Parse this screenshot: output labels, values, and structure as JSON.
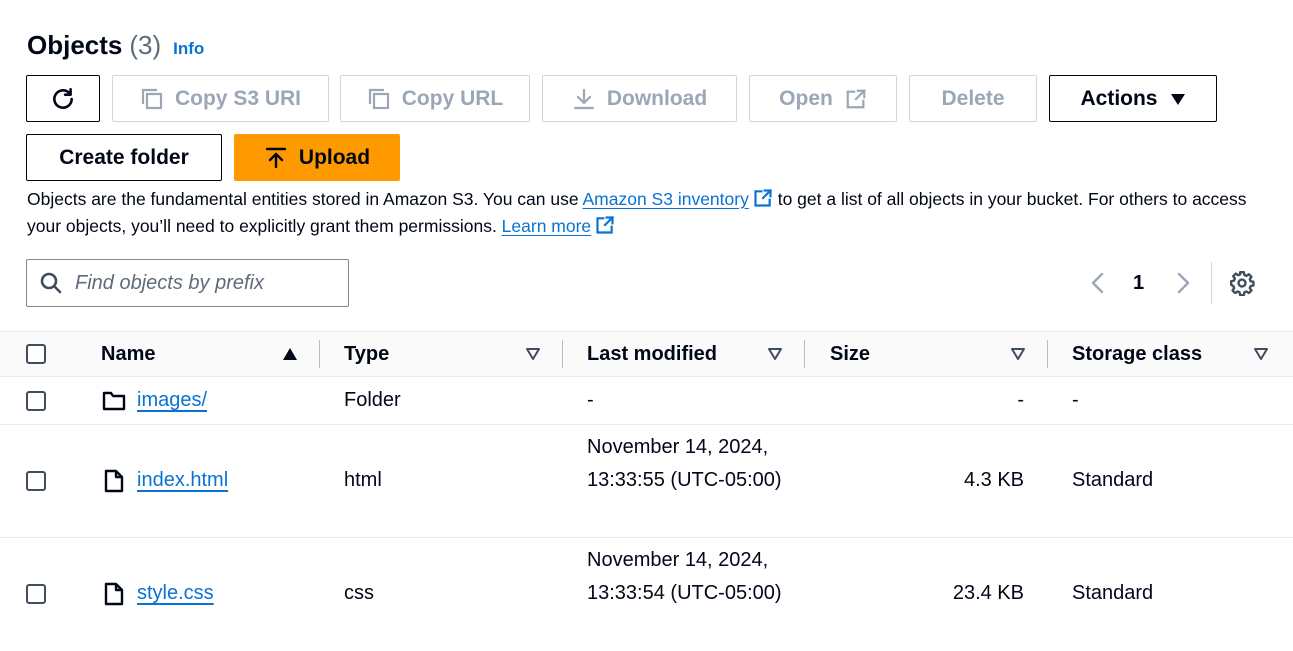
{
  "header": {
    "title": "Objects",
    "count": "(3)",
    "info": "Info"
  },
  "toolbar": {
    "copy_s3_uri": "Copy S3 URI",
    "copy_url": "Copy URL",
    "download": "Download",
    "open": "Open",
    "delete": "Delete",
    "actions": "Actions",
    "create_folder": "Create folder",
    "upload": "Upload"
  },
  "description": {
    "part1": "Objects are the fundamental entities stored in Amazon S3. You can use ",
    "link1": "Amazon S3 inventory",
    "part2": " to get a list of all objects in your bucket. For others to access your objects, you’ll need to explicitly grant them permissions. ",
    "link2": "Learn more"
  },
  "search": {
    "placeholder": "Find objects by prefix",
    "value": ""
  },
  "pagination": {
    "current_page": "1"
  },
  "table": {
    "columns": [
      "Name",
      "Type",
      "Last modified",
      "Size",
      "Storage class"
    ],
    "rows": [
      {
        "name": "images/",
        "type": "Folder",
        "last_modified": "-",
        "size": "-",
        "storage_class": "-",
        "icon": "folder-icon"
      },
      {
        "name": "index.html",
        "type": "html",
        "last_modified": "November 14, 2024, 13:33:55 (UTC-05:00)",
        "size": "4.3 KB",
        "storage_class": "Standard",
        "icon": "file-icon"
      },
      {
        "name": "style.css",
        "type": "css",
        "last_modified": "November 14, 2024, 13:33:54 (UTC-05:00)",
        "size": "23.4 KB",
        "storage_class": "Standard",
        "icon": "file-icon"
      }
    ]
  },
  "colors": {
    "link": "#0972d3",
    "primary": "#ff9900",
    "disabled": "#9ba7b6",
    "text": "#000716"
  }
}
